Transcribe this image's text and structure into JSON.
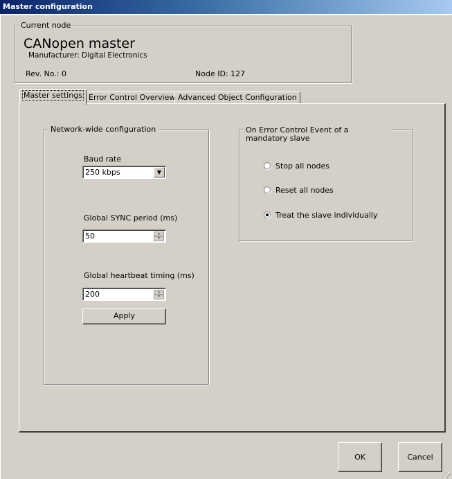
{
  "window": {
    "title": "Master configuration"
  },
  "current_node": {
    "legend": "Current node",
    "name": "CANopen master",
    "manufacturer": "Manufacturer: Digital Electronics",
    "rev": "Rev. No.: 0",
    "node_id": "Node ID: 127"
  },
  "tabs": [
    {
      "label": "Master settings",
      "active": true
    },
    {
      "label": "Error Control Overview",
      "active": false
    },
    {
      "label": "Advanced Object Configuration",
      "active": false
    }
  ],
  "network": {
    "legend": "Network-wide configuration",
    "baud_label": "Baud rate",
    "baud_value": "250 kbps",
    "sync_label": "Global SYNC period (ms)",
    "sync_value": "50",
    "heartbeat_label": "Global heartbeat timing (ms)",
    "heartbeat_value": "200",
    "apply_label": "Apply"
  },
  "error_control": {
    "legend": "On Error Control Event of a mandatory slave",
    "options": [
      {
        "label": "Stop all nodes",
        "checked": false
      },
      {
        "label": "Reset all nodes",
        "checked": false
      },
      {
        "label": "Treat the slave individually",
        "checked": true
      }
    ]
  },
  "footer": {
    "ok_label": "OK",
    "cancel_label": "Cancel"
  }
}
